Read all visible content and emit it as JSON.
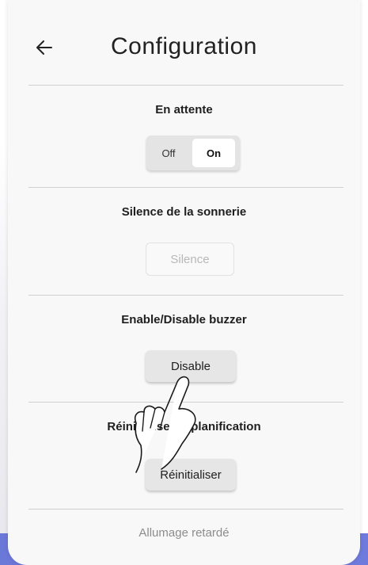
{
  "header": {
    "title": "Configuration",
    "back_icon": "arrow-left-icon"
  },
  "sections": [
    {
      "title": "En attente",
      "toggle": {
        "off_label": "Off",
        "on_label": "On",
        "selected": "On"
      }
    },
    {
      "title": "Silence de la sonnerie",
      "button_label": "Silence",
      "button_enabled": false
    },
    {
      "title": "Enable/Disable buzzer",
      "button_label": "Disable",
      "button_enabled": true
    },
    {
      "title": "Réinitialiser la planification",
      "button_label": "Réinitialiser",
      "button_enabled": true
    },
    {
      "title": "Allumage retardé"
    }
  ],
  "overlay": {
    "icon": "tap-hand-icon"
  },
  "colors": {
    "bottom_gradient": "#6a78d8",
    "card_background": "#f8f8f8"
  }
}
